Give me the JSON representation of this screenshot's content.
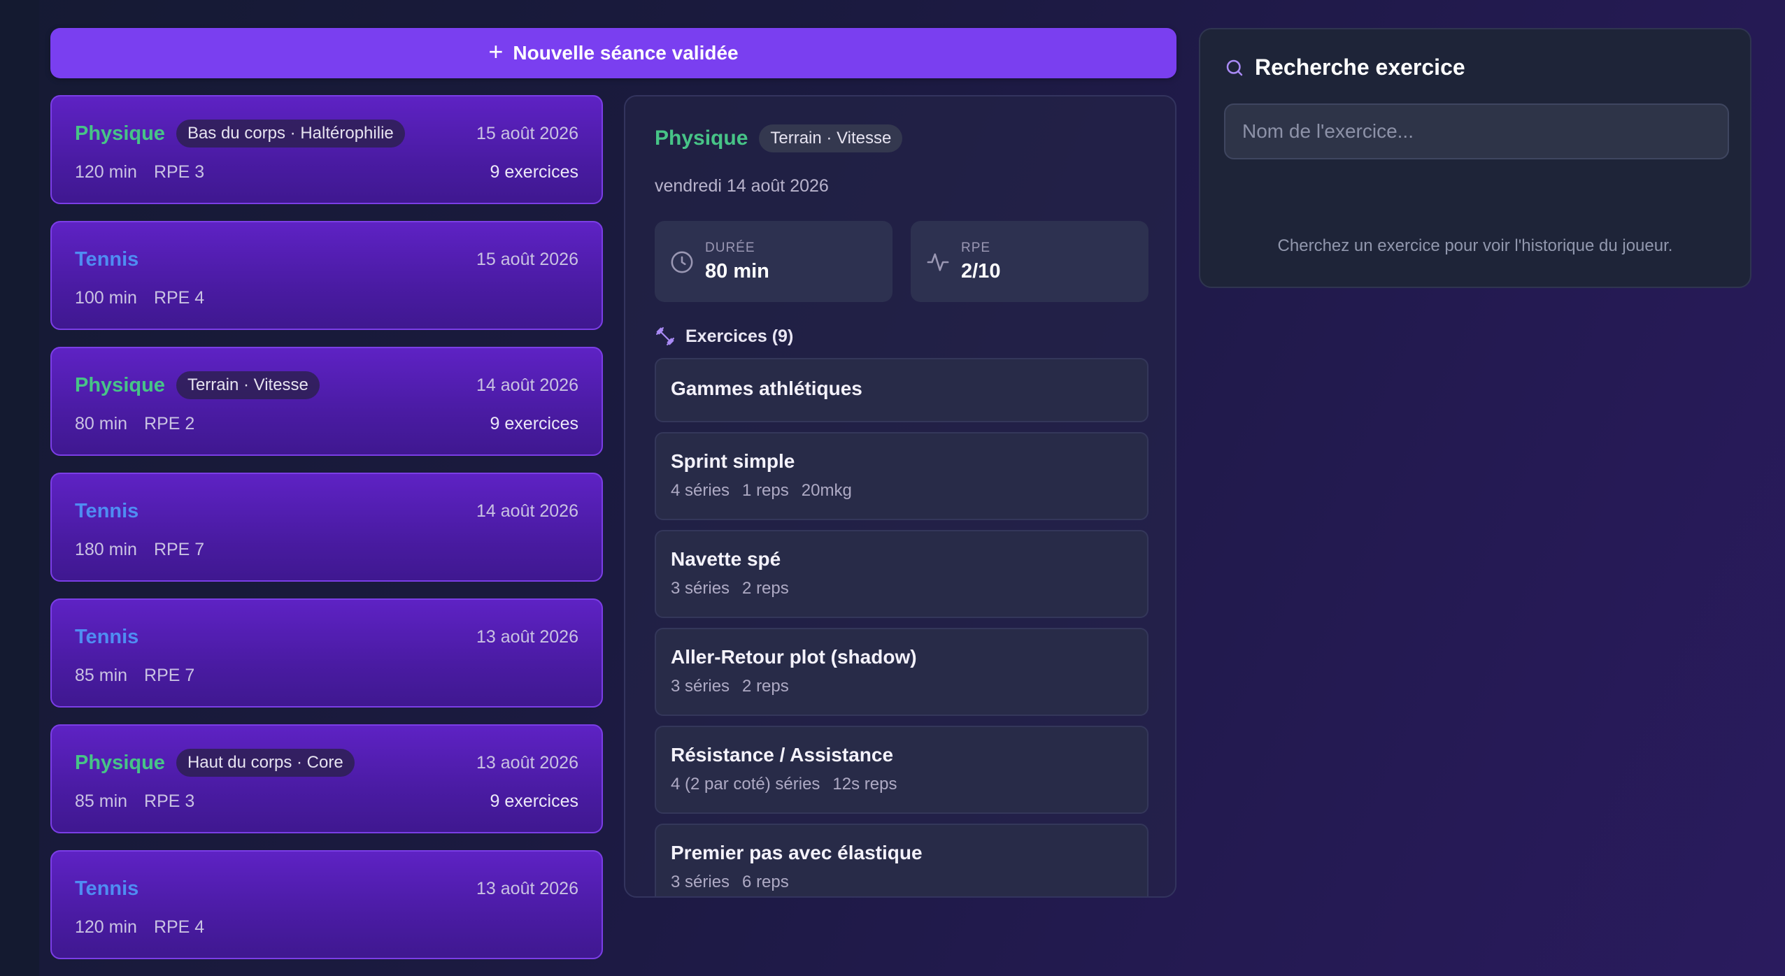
{
  "new_session_button": {
    "label": "Nouvelle séance validée"
  },
  "sessions": [
    {
      "type": "Physique",
      "type_kind": "physique",
      "tag": "Bas du corps · Haltérophilie",
      "date": "15 août 2026",
      "duration": "120 min",
      "rpe": "RPE 3",
      "exercises": "9 exercices"
    },
    {
      "type": "Tennis",
      "type_kind": "tennis",
      "tag": "",
      "date": "15 août 2026",
      "duration": "100 min",
      "rpe": "RPE 4",
      "exercises": ""
    },
    {
      "type": "Physique",
      "type_kind": "physique",
      "tag": "Terrain · Vitesse",
      "date": "14 août 2026",
      "duration": "80 min",
      "rpe": "RPE 2",
      "exercises": "9 exercices"
    },
    {
      "type": "Tennis",
      "type_kind": "tennis",
      "tag": "",
      "date": "14 août 2026",
      "duration": "180 min",
      "rpe": "RPE 7",
      "exercises": ""
    },
    {
      "type": "Tennis",
      "type_kind": "tennis",
      "tag": "",
      "date": "13 août 2026",
      "duration": "85 min",
      "rpe": "RPE 7",
      "exercises": ""
    },
    {
      "type": "Physique",
      "type_kind": "physique",
      "tag": "Haut du corps · Core",
      "date": "13 août 2026",
      "duration": "85 min",
      "rpe": "RPE 3",
      "exercises": "9 exercices"
    },
    {
      "type": "Tennis",
      "type_kind": "tennis",
      "tag": "",
      "date": "13 août 2026",
      "duration": "120 min",
      "rpe": "RPE 4",
      "exercises": ""
    }
  ],
  "detail": {
    "type": "Physique",
    "tag": "Terrain · Vitesse",
    "date_full": "vendredi 14 août 2026",
    "duration_label": "DURÉE",
    "duration_value": "80 min",
    "rpe_label": "RPE",
    "rpe_value": "2/10",
    "exercises_header": "Exercices (9)",
    "exercises": [
      {
        "name": "Gammes athlétiques",
        "meta": []
      },
      {
        "name": "Sprint simple",
        "meta": [
          "4 séries",
          "1 reps",
          "20mkg"
        ]
      },
      {
        "name": "Navette spé",
        "meta": [
          "3 séries",
          "2 reps"
        ]
      },
      {
        "name": "Aller-Retour plot (shadow)",
        "meta": [
          "3 séries",
          "2 reps"
        ]
      },
      {
        "name": "Résistance / Assistance",
        "meta": [
          "4 (2 par coté) séries",
          "12s reps"
        ]
      },
      {
        "name": "Premier pas avec élastique",
        "meta": [
          "3 séries",
          "6 reps"
        ]
      }
    ]
  },
  "search": {
    "title": "Recherche exercice",
    "placeholder": "Nom de l'exercice...",
    "hint": "Cherchez un exercice pour voir l'historique du joueur."
  },
  "colors": {
    "accent": "#7a3ff0",
    "physique": "#47c487",
    "tennis": "#4f8df2"
  },
  "icons": {
    "new_session": "plus-icon",
    "duration": "clock-icon",
    "rpe": "activity-icon",
    "exercises": "dumbbell-icon",
    "search": "search-icon"
  }
}
